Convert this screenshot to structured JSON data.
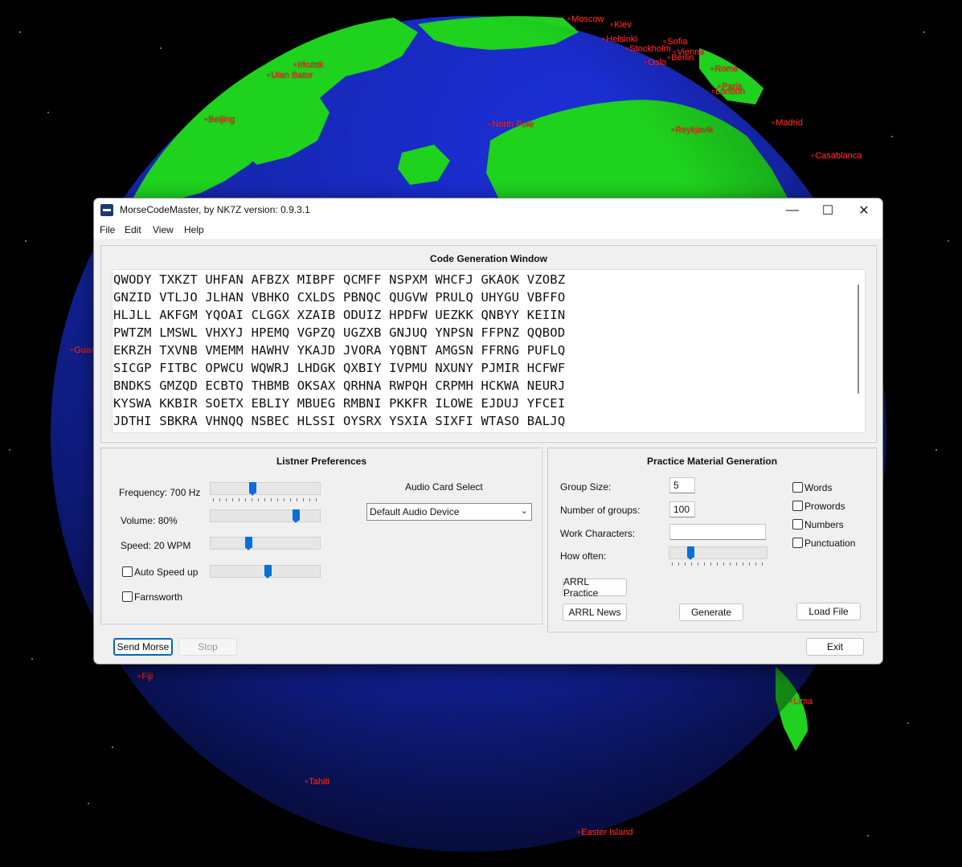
{
  "window": {
    "title": "MorseCodeMaster, by NK7Z version: 0.9.3.1",
    "minimize_glyph": "—",
    "maximize_glyph": "☐",
    "close_glyph": "✕"
  },
  "menu": [
    "File",
    "Edit",
    "View",
    "Help"
  ],
  "code_window": {
    "title": "Code Generation Window",
    "lines": [
      "QWODY TXKZT UHFAN AFBZX MIBPF QCMFF NSPXM WHCFJ GKAOK VZOBZ",
      "GNZID VTLJO JLHAN VBHKO CXLDS PBNQC QUGVW PRULQ UHYGU VBFFO",
      "HLJLL AKFGM YQOAI CLGGX XZAIB ODUIZ HPDFW UEZKK QNBYY KEIIN",
      "PWTZM LMSWL VHXYJ HPEMQ VGPZQ UGZXB GNJUQ YNPSN FFPNZ QQBOD",
      "EKRZH TXVNB VMEMM HAWHV YKAJD JVORA YQBNT AMGSN FFRNG PUFLQ",
      "SICGP FITBC OPWCU WQWRJ LHDGK QXBIY IVPMU NXUNY PJMIR HCFWF",
      "BNDKS GMZQD ECBTQ THBMB OKSAX QRHNA RWPQH CRPMH HCKWA NEURJ",
      "KYSWA KKBIR SOETX EBLIY MBUEG RMBNI PKKFR ILOWE EJDUJ YFCEI",
      "JDTHI SBKRA VHNQQ NSBEC HLSSI OYSRX YSXIA SIXFI WTASO BALJQ"
    ]
  },
  "listener": {
    "title": "Listner Preferences",
    "frequency_label": "Frequency: 700 Hz",
    "frequency_level": 0.38,
    "volume_label": "Volume: 80%",
    "volume_level": 0.8,
    "speed_label": "Speed: 20 WPM",
    "speed_level": 0.34,
    "auto_speed_label": "Auto Speed up",
    "auto_speed_level": 0.53,
    "farnsworth_label": "Farnsworth",
    "audio_card_label": "Audio Card Select",
    "audio_device": "Default Audio Device"
  },
  "practice": {
    "title": "Practice Material Generation",
    "group_size_label": "Group Size:",
    "group_size_value": "5",
    "num_groups_label": "Number of groups:",
    "num_groups_value": "100",
    "work_chars_label": "Work Characters:",
    "work_chars_value": "",
    "how_often_label": "How often:",
    "how_often_level": 0.2,
    "checkboxes": [
      "Words",
      "Prowords",
      "Numbers",
      "Punctuation"
    ],
    "arrl_practice": "ARRL Practice",
    "arrl_news": "ARRL News",
    "generate": "Generate",
    "load_file": "Load File"
  },
  "footer": {
    "send_morse": "Send Morse",
    "stop": "Stop",
    "exit": "Exit"
  },
  "cities": [
    "Moscow",
    "Kiev",
    "Helsinki",
    "Sofia",
    "Stockholm",
    "Vienna",
    "Oslo",
    "Berlin",
    "Irkutsk",
    "Ulan Bator",
    "Rome",
    "Paris",
    "London",
    "Beijing",
    "North Pole",
    "Reykjavik",
    "Madrid",
    "Casablanca",
    "Guam",
    "Fiji",
    "Lima",
    "Tahiti",
    "Easter Island"
  ]
}
